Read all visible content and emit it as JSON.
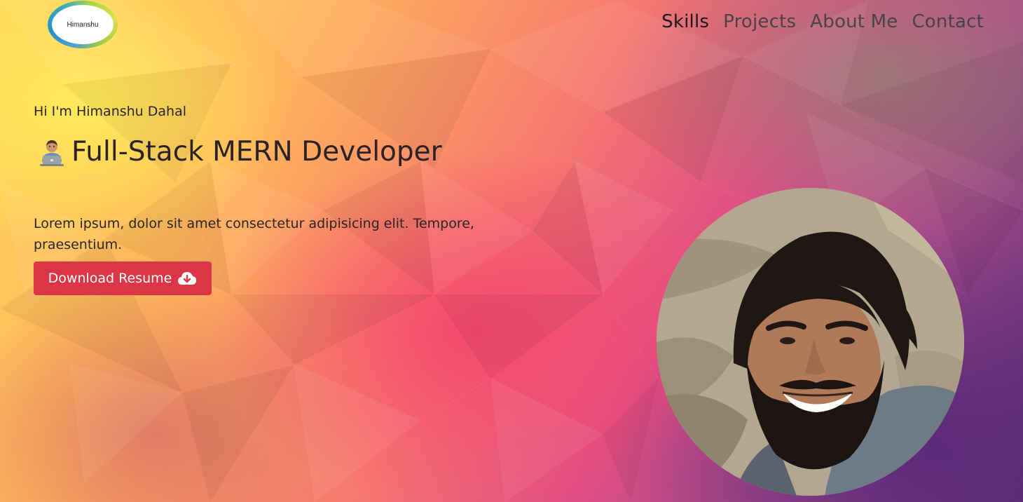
{
  "header": {
    "logo_text": "Himanshu",
    "nav": [
      {
        "label": "Skills",
        "active": true
      },
      {
        "label": "Projects",
        "active": false
      },
      {
        "label": "About Me",
        "active": false
      },
      {
        "label": "Contact",
        "active": false
      }
    ]
  },
  "hero": {
    "greeting": "Hi I'm Himanshu Dahal",
    "headline_icon": "technologist-emoji",
    "headline": "Full-Stack MERN Developer",
    "description": "Lorem ipsum, dolor sit amet consectetur adipisicing elit. Tempore, praesentium.",
    "download_button": {
      "label": "Download Resume",
      "icon": "cloud-download-icon"
    }
  },
  "portrait": {
    "subject": "profile-photo"
  },
  "colors": {
    "button": "#dc3545",
    "nav_text": "#4a4248",
    "nav_active": "#1e1a1d",
    "body_text": "#2b2427"
  }
}
